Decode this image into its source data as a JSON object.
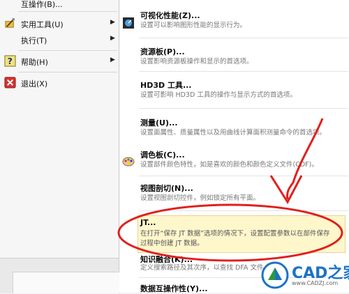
{
  "left_menu": {
    "items": [
      {
        "label": "互操作(B)...",
        "has_arrow": false
      },
      {
        "label": "实用工具(U)",
        "has_arrow": true
      },
      {
        "label": "执行(T)",
        "has_arrow": true
      },
      {
        "label": "帮助(H)",
        "has_arrow": true
      },
      {
        "label": "退出(X)",
        "has_arrow": false
      }
    ]
  },
  "submenu": {
    "items": [
      {
        "title": "可视化性能(Z)...",
        "desc": [
          "设置可以影响图形性能的显示行为。"
        ]
      },
      {
        "title": "资源板(P)...",
        "desc": [
          "设置影响资源板操作和显示的首选项。"
        ]
      },
      {
        "title": "HD3D 工具...",
        "desc": [
          "设置可影响 HD3D 工具的操作与显示方式的首选项。"
        ]
      },
      {
        "title": "测量(U)...",
        "desc": [
          "设置面属性、质量属性以及用曲线计算面积测量命令的首选项。"
        ]
      },
      {
        "title": "调色板(C)...",
        "desc": [
          "设置部件颜色特性，如是喜欢的颜色和颜色定义文件(CDF)。"
        ]
      },
      {
        "title": "视图剖切(N)...",
        "desc": [
          "设置视图剖切控件，例如锁定所有平面。"
        ]
      },
      {
        "title": "JT...",
        "desc": [
          "在打开“保存 JT 数据”选项的情况下，设置配置参数以在部件保存",
          "过程中创建 JT 数据。"
        ]
      },
      {
        "title": "知识融合(K)...",
        "desc": [
          "定义搜索路径及其次序，以查找 DFA 文件。"
        ]
      },
      {
        "title": "数据互操作性(Y)..."
      }
    ]
  },
  "watermark": {
    "brand": "CAD之家",
    "url": "www.CADZJ.com"
  },
  "colors": {
    "annotation_red": "#e0201e",
    "highlight_bg": "#fff7cc",
    "brand_blue": "#1a73c5"
  }
}
